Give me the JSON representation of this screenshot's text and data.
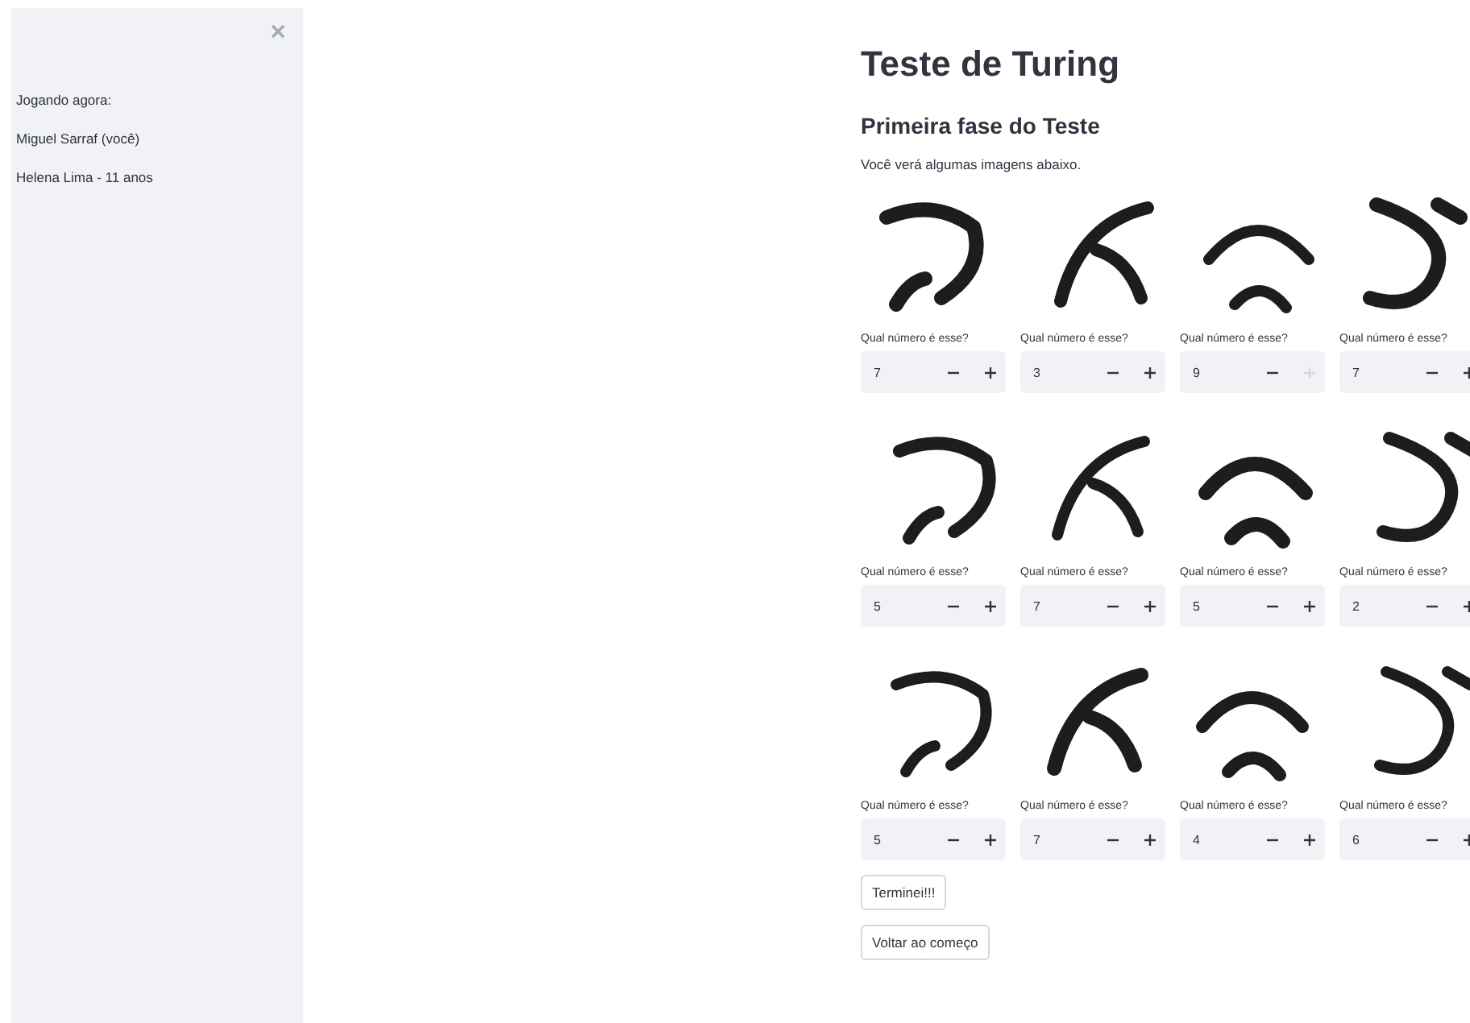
{
  "sidebar": {
    "heading": "Jogando agora:",
    "players": [
      "Miguel Sarraf (você)",
      "Helena Lima - 11 anos"
    ]
  },
  "title": "Teste de Turing",
  "subtitle": "Primeira fase do Teste",
  "description": "Você verá algumas imagens abaixo.",
  "cells": [
    {
      "label": "Qual número é esse?",
      "value": "7",
      "plus_disabled": false
    },
    {
      "label": "Qual número é esse?",
      "value": "3",
      "plus_disabled": false
    },
    {
      "label": "Qual número é esse?",
      "value": "9",
      "plus_disabled": true
    },
    {
      "label": "Qual número é esse?",
      "value": "7",
      "plus_disabled": false
    },
    {
      "label": "Qual número é esse?",
      "value": "5",
      "plus_disabled": false
    },
    {
      "label": "Qual número é esse?",
      "value": "7",
      "plus_disabled": false
    },
    {
      "label": "Qual número é esse?",
      "value": "5",
      "plus_disabled": false
    },
    {
      "label": "Qual número é esse?",
      "value": "2",
      "plus_disabled": false
    },
    {
      "label": "Qual número é esse?",
      "value": "5",
      "plus_disabled": false
    },
    {
      "label": "Qual número é esse?",
      "value": "7",
      "plus_disabled": false
    },
    {
      "label": "Qual número é esse?",
      "value": "4",
      "plus_disabled": false
    },
    {
      "label": "Qual número é esse?",
      "value": "6",
      "plus_disabled": false
    }
  ],
  "buttons": [
    "Terminei!!!",
    "Voltar ao começo"
  ]
}
